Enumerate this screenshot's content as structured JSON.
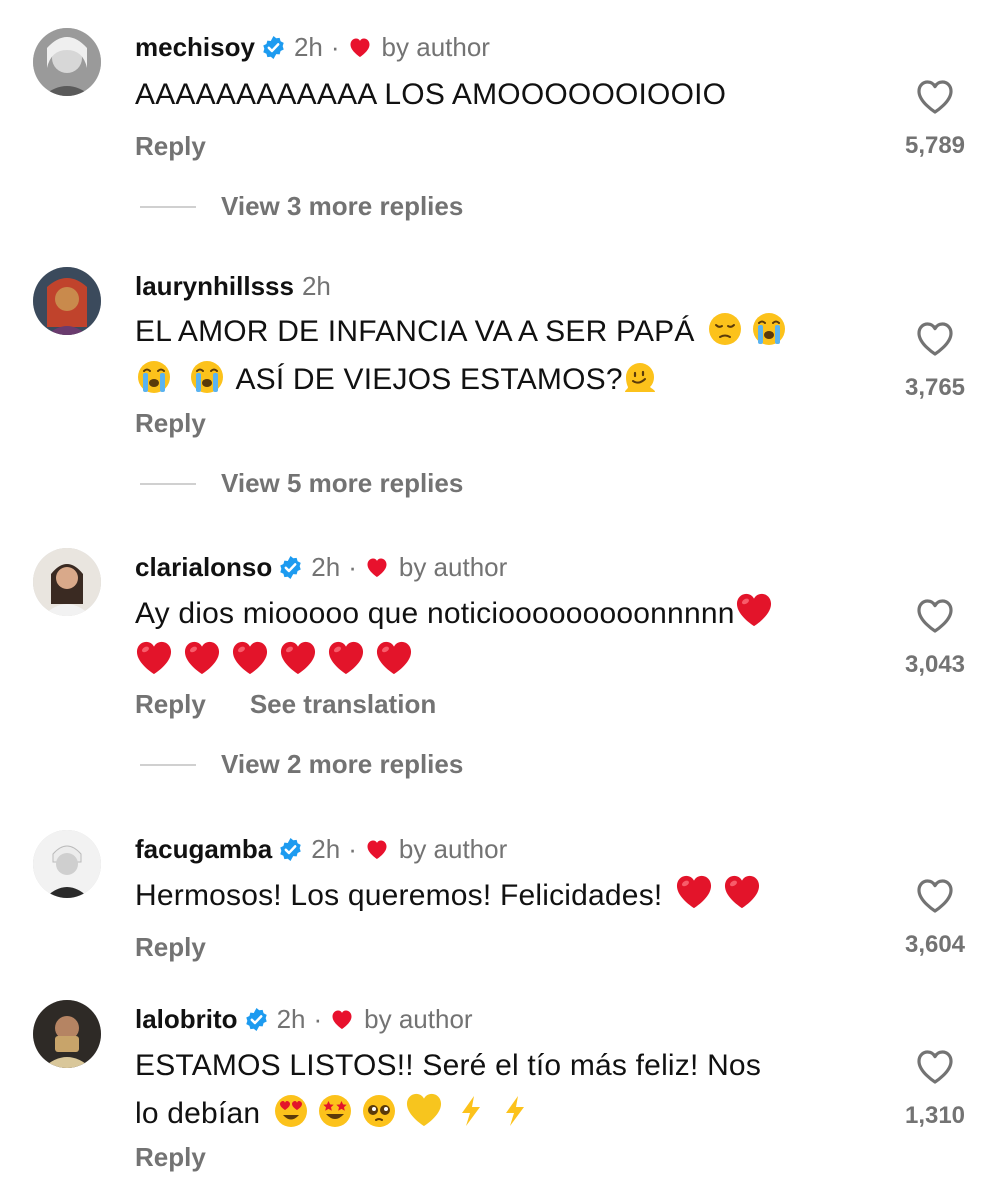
{
  "colors": {
    "username": "#111111",
    "secondary": "#737373",
    "verified": "#1d9bf0",
    "author_heart": "#e8112d",
    "divider": "#d0d0d0"
  },
  "actions": {
    "reply_label": "Reply",
    "see_translation_label": "See translation"
  },
  "comments": [
    {
      "username": "mechisoy",
      "verified": true,
      "time": "2h",
      "liked_by_author": true,
      "by_author_label": "by author",
      "text": "AAAAAAAAAAAA LOS AMOOOOOOIOOIO",
      "likes": "5,789",
      "view_replies": "View 3 more replies"
    },
    {
      "username": "laurynhillsss",
      "verified": false,
      "time": "2h",
      "liked_by_author": false,
      "text_line1": "EL AMOR DE INFANCIA VA A SER PAPÁ",
      "text_line2": "ASÍ DE VIEJOS ESTAMOS?",
      "emojis": [
        "pensive-face",
        "loudly-crying-face",
        "loudly-crying-face",
        "loudly-crying-face",
        "melting-face"
      ],
      "likes": "3,765",
      "view_replies": "View 5 more replies"
    },
    {
      "username": "clarialonso",
      "verified": true,
      "time": "2h",
      "liked_by_author": true,
      "by_author_label": "by author",
      "text": "Ay dios miooooo que noticiooooooooonnnnn",
      "emojis": [
        "red-heart",
        "red-heart",
        "red-heart",
        "red-heart",
        "red-heart",
        "red-heart",
        "red-heart"
      ],
      "likes": "3,043",
      "view_replies": "View 2 more replies"
    },
    {
      "username": "facugamba",
      "verified": true,
      "time": "2h",
      "liked_by_author": true,
      "by_author_label": "by author",
      "text": "Hermosos! Los queremos! Felicidades!",
      "emojis": [
        "red-heart",
        "red-heart"
      ],
      "likes": "3,604"
    },
    {
      "username": "lalobrito",
      "verified": true,
      "time": "2h",
      "liked_by_author": true,
      "by_author_label": "by author",
      "text_line1": "ESTAMOS LISTOS!! Seré el tío más feliz! Nos",
      "text_line2": "lo debían",
      "emojis": [
        "heart-eyes-face",
        "star-struck-face",
        "pleading-face",
        "yellow-heart",
        "high-voltage",
        "high-voltage"
      ],
      "likes": "1,310"
    }
  ]
}
